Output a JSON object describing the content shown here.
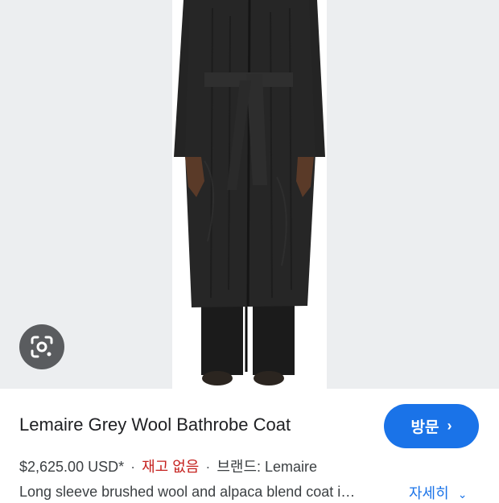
{
  "product": {
    "title": "Lemaire Grey Wool Bathrobe Coat",
    "price": "$2,625.00 USD*",
    "stock_status": "재고 없음",
    "brand": "브랜드: Lemaire",
    "separator": "·",
    "description": "Long sleeve brushed wool and alpaca blend coat i…"
  },
  "actions": {
    "visit_label": "방문",
    "more_label": "자세히"
  },
  "icons": {
    "lens": "google-lens-icon",
    "visit_chevron": "chevron-right-icon",
    "more_chevron": "chevron-down-icon"
  },
  "colors": {
    "accent": "#1a73e8",
    "stock_out": "#c5221f",
    "image_background": "#eceef0",
    "lens_button": "#5a5c5f"
  }
}
